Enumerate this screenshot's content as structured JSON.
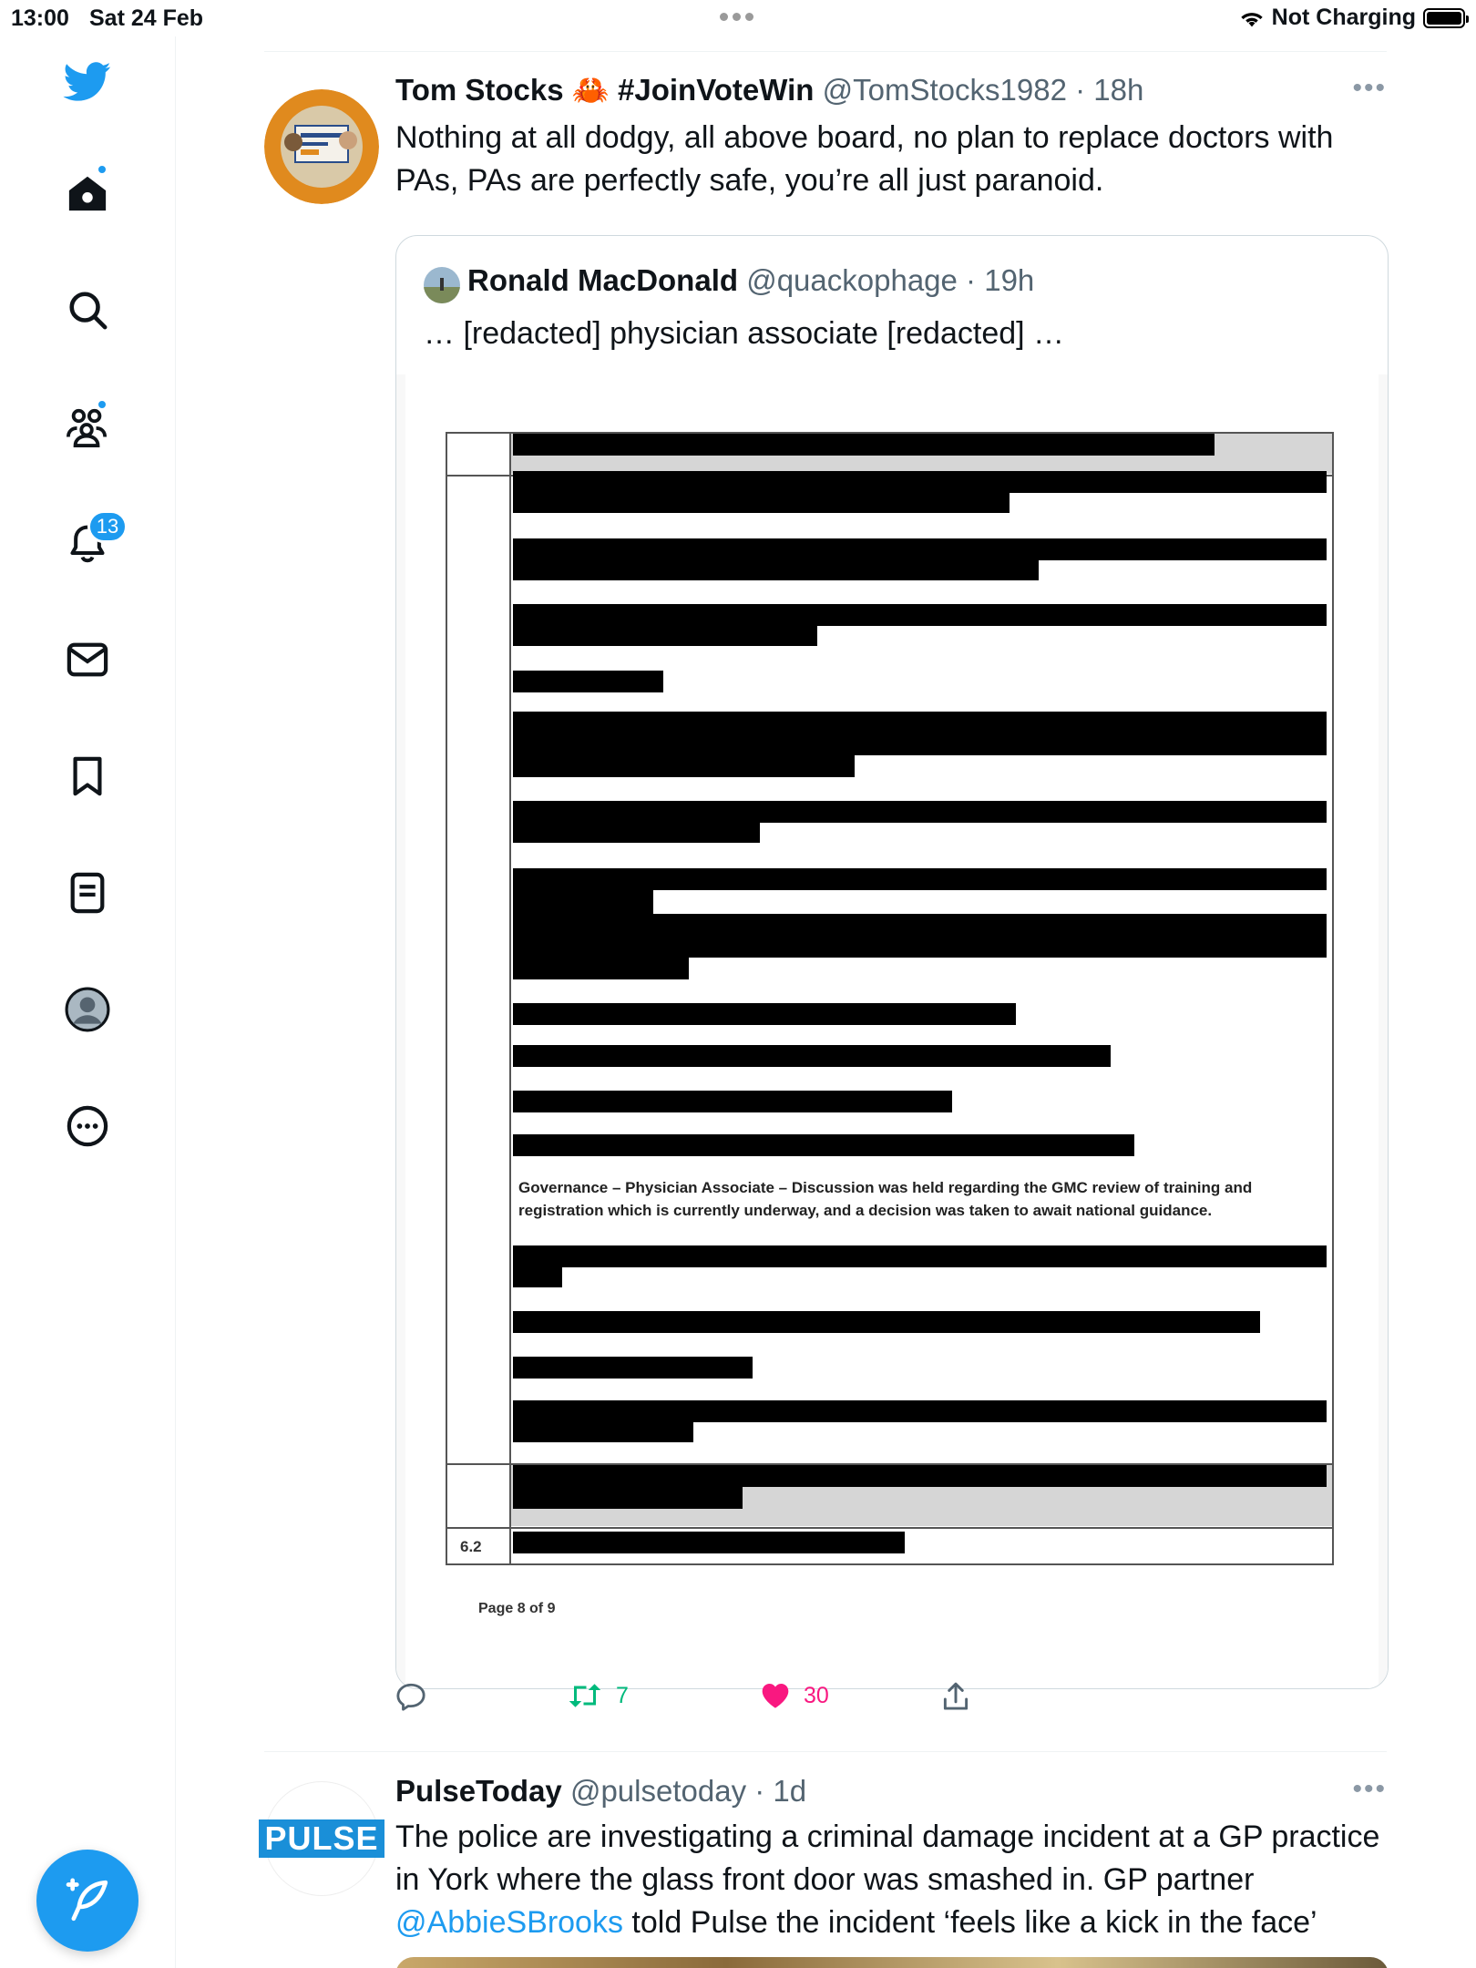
{
  "status_bar": {
    "time": "13:00",
    "date": "Sat 24 Feb",
    "charging": "Not Charging"
  },
  "sidebar": {
    "items": [
      {
        "name": "twitter-logo"
      },
      {
        "name": "home"
      },
      {
        "name": "explore"
      },
      {
        "name": "communities"
      },
      {
        "name": "notifications",
        "badge": "13"
      },
      {
        "name": "messages"
      },
      {
        "name": "bookmarks"
      },
      {
        "name": "lists"
      },
      {
        "name": "profile"
      },
      {
        "name": "more"
      }
    ],
    "accent": "#1d9bf0"
  },
  "tweets": [
    {
      "name": "Tom Stocks 🦀 #JoinVoteWin",
      "handle": "@TomStocks1982",
      "time": "18h",
      "text": "Nothing at all dodgy, all above board, no plan to replace doctors with PAs, PAs are perfectly safe, you’re all just paranoid.",
      "quote": {
        "name": "Ronald MacDonald",
        "handle": "@quackophage",
        "time": "19h",
        "text": "… [redacted] physician associate [redacted] …",
        "document": {
          "text": "Governance – Physician Associate – Discussion was held regarding the GMC review of training and registration which is currently underway, and a decision was taken to await national guidance.",
          "row_number": "6.2",
          "page": "Page 8 of 9"
        }
      },
      "actions": {
        "reply": "",
        "retweets": "7",
        "likes": "30",
        "share": ""
      }
    },
    {
      "name": "PulseToday",
      "handle": "@pulsetoday",
      "time": "1d",
      "logo_text": "PULSE",
      "text_before": "The police are investigating a criminal damage incident at a GP practice in York where the glass front door was smashed in. GP partner",
      "mention": "@AbbieSBrooks",
      "text_after": " told Pulse the incident ‘feels like a kick in the face’"
    }
  ],
  "colors": {
    "retweet": "#00ba7c",
    "like": "#f91880",
    "link": "#1d9bf0"
  }
}
